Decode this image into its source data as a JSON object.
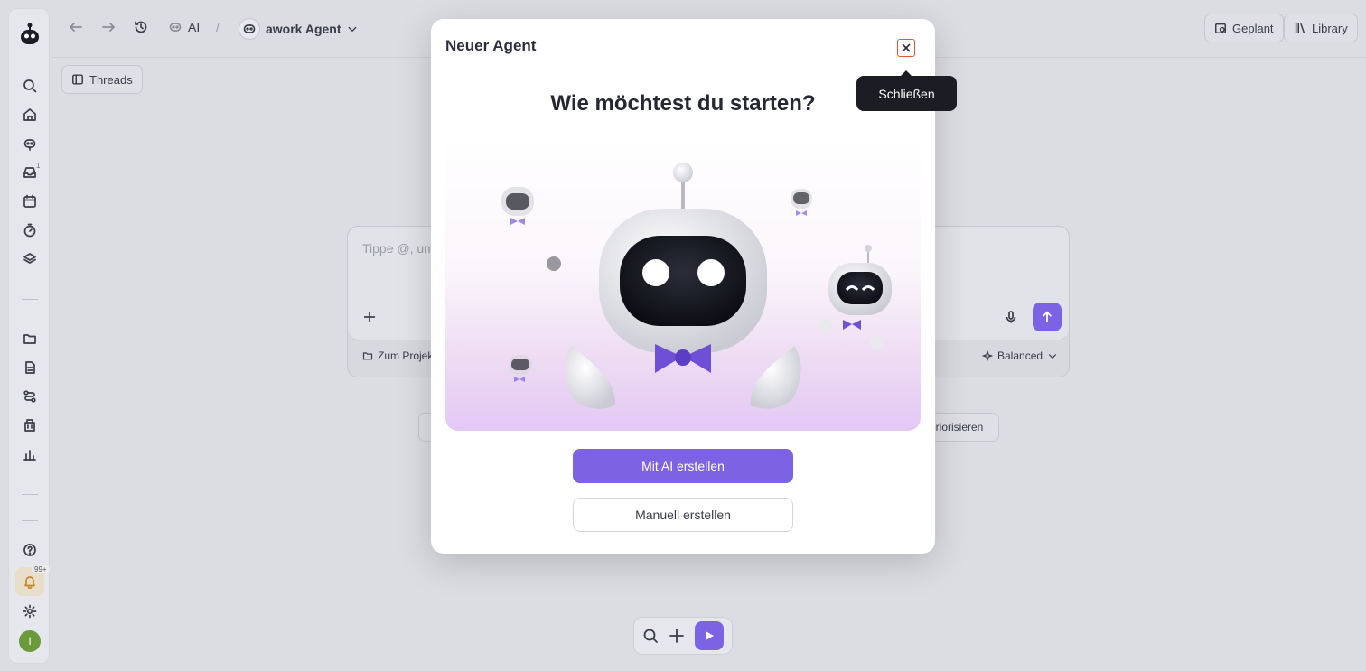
{
  "topbar": {
    "breadcrumb_ai": "AI",
    "breadcrumb_sep": "/",
    "agent_name": "awork Agent",
    "scheduled_label": "Geplant",
    "library_label": "Library"
  },
  "threads_label": "Threads",
  "sidebar": {
    "inbox_badge": "1",
    "notifications_badge": "99+",
    "avatar_initial": "I"
  },
  "composer": {
    "placeholder": "Tippe @, um",
    "project_label": "Zum Projekt",
    "mode_label": "Balanced"
  },
  "suggestion_tail": "priorisieren",
  "modal": {
    "title": "Neuer Agent",
    "heading": "Wie möchtest du starten?",
    "primary_button": "Mit AI erstellen",
    "secondary_button": "Manuell erstellen",
    "close_tooltip": "Schließen"
  },
  "colors": {
    "accent": "#7b63e3",
    "close_highlight": "#e0563b"
  }
}
